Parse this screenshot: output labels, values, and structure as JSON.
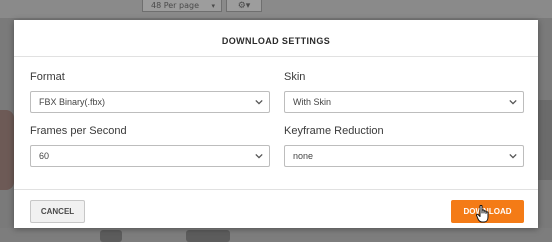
{
  "background": {
    "per_page_label": "48 Per page"
  },
  "modal": {
    "title": "DOWNLOAD SETTINGS",
    "fields": [
      {
        "label": "Format",
        "value": "FBX Binary(.fbx)"
      },
      {
        "label": "Skin",
        "value": "With Skin"
      },
      {
        "label": "Frames per Second",
        "value": "60"
      },
      {
        "label": "Keyframe Reduction",
        "value": "none"
      }
    ],
    "buttons": {
      "cancel": "CANCEL",
      "download": "DOWNLOAD"
    }
  },
  "colors": {
    "accent": "#f47b16",
    "overlay": "#7a7a7a"
  },
  "icons": {
    "select_chevron": "chevron-down-icon",
    "settings": "gear-icon",
    "cursor": "hand-pointer-icon"
  }
}
